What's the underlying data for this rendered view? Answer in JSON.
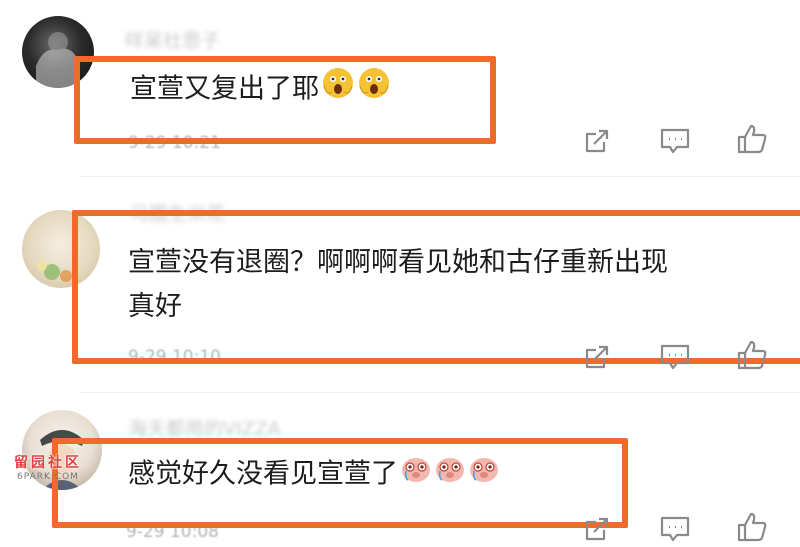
{
  "comments": [
    {
      "username": "咩呆社恩子",
      "text": "宣萱又复出了耶",
      "emoji": "scream-emoji",
      "time": "9-29 10:21"
    },
    {
      "username": "马圈生米花",
      "text_line1": "宣萱没有退圈？啊啊啊看见她和古仔重新出现",
      "text_line2": "真好",
      "time": "9-29 10:10"
    },
    {
      "username": "海天都用的VIZZA",
      "text": "感觉好久没看见宣萱了",
      "emoji": "teary-pig-emoji",
      "time": "9-29 10:08"
    }
  ],
  "watermark": {
    "cn": "留园社区",
    "en": "6PARK.COM"
  },
  "colors": {
    "highlight": "#f26a2b",
    "icon": "#8a8a8a"
  }
}
